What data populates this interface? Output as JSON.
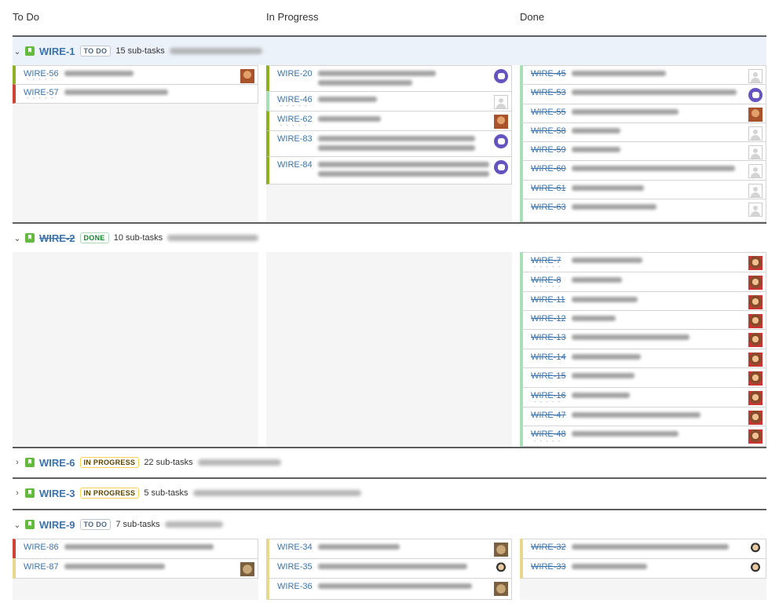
{
  "columns": [
    "To Do",
    "In Progress",
    "Done"
  ],
  "swimlanes": [
    {
      "key": "WIRE-1",
      "status": "TO DO",
      "subtasks": "15 sub-tasks",
      "expanded": true,
      "done": false
    },
    {
      "key": "WIRE-2",
      "status": "DONE",
      "subtasks": "10 sub-tasks",
      "expanded": true,
      "done": true
    },
    {
      "key": "WIRE-6",
      "status": "IN PROGRESS",
      "subtasks": "22 sub-tasks",
      "expanded": false,
      "done": false
    },
    {
      "key": "WIRE-3",
      "status": "IN PROGRESS",
      "subtasks": "5 sub-tasks",
      "expanded": false,
      "done": false
    },
    {
      "key": "WIRE-9",
      "status": "TO DO",
      "subtasks": "7 sub-tasks",
      "expanded": true,
      "done": false
    }
  ],
  "cards": {
    "wire1_todo": [
      "WIRE-56",
      "WIRE-57"
    ],
    "wire1_progress": [
      "WIRE-20",
      "WIRE-46",
      "WIRE-62",
      "WIRE-83",
      "WIRE-84"
    ],
    "wire1_done": [
      "WIRE-45",
      "WIRE-53",
      "WIRE-55",
      "WIRE-58",
      "WIRE-59",
      "WIRE-60",
      "WIRE-61",
      "WIRE-63"
    ],
    "wire2_done": [
      "WIRE-7",
      "WIRE-8",
      "WIRE-11",
      "WIRE-12",
      "WIRE-13",
      "WIRE-14",
      "WIRE-15",
      "WIRE-16",
      "WIRE-47",
      "WIRE-48"
    ],
    "wire9_todo": [
      "WIRE-86",
      "WIRE-87"
    ],
    "wire9_progress": [
      "WIRE-34",
      "WIRE-35",
      "WIRE-36"
    ],
    "wire9_done": [
      "WIRE-32",
      "WIRE-33"
    ]
  },
  "icons": {
    "expanded": "chevron-down-icon",
    "collapsed": "chevron-right-icon",
    "story": "story-icon"
  },
  "colors": {
    "link": "#3b73af",
    "story": "#63ba3c",
    "lane_bg": "#ebf2f9"
  }
}
